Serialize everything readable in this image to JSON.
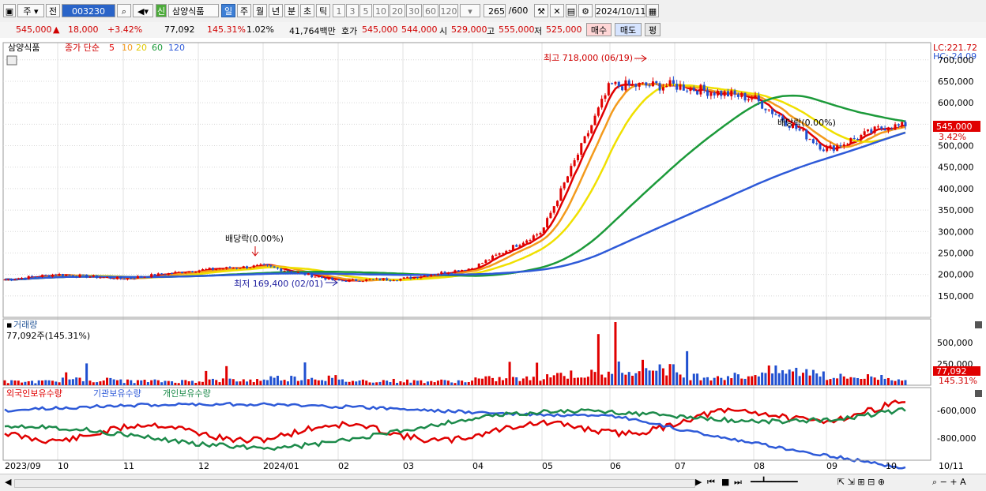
{
  "toolbar": {
    "market": "주",
    "code_type": "전",
    "code": "003230",
    "badge": "신",
    "stock_name": "삼양식품",
    "periods": [
      "일",
      "주",
      "월",
      "년",
      "분",
      "초",
      "틱"
    ],
    "active_period": "일",
    "numbers": [
      "1",
      "3",
      "5",
      "10",
      "20",
      "30",
      "60",
      "120"
    ],
    "count": "265",
    "count_max": "/600",
    "date": "2024/10/11"
  },
  "quote": {
    "price": "545,000",
    "change": "18,000",
    "change_pct": "+3.42%",
    "volume": "77,092",
    "volume_ratio": "145.31%",
    "turnover": "1.02%",
    "amount": "41,764백만",
    "bid_label": "호가",
    "bid1": "545,000",
    "bid2": "544,000",
    "open_label": "시",
    "open": "529,000",
    "high_label": "고",
    "high": "555,000",
    "low_label": "저",
    "low": "525,000",
    "buy_button": "매수",
    "sell_button": "매도",
    "eval_button": "평"
  },
  "price_panel": {
    "stock_tag": "삼양식품",
    "indicator_label": "종가 단순",
    "ma_periods": [
      {
        "label": "5",
        "color": "#e00000"
      },
      {
        "label": "10",
        "color": "#f39a1c"
      },
      {
        "label": "20",
        "color": "#f0e000"
      },
      {
        "label": "60",
        "color": "#1c9a3a"
      },
      {
        "label": "120",
        "color": "#2e5ad8"
      }
    ],
    "lc": "LC:221.72",
    "hc": "HC:-24.09",
    "current_tag": "545,000",
    "current_pct": "3.42%",
    "high_note": "최고 718,000 (06/19)",
    "low_note": "최저 169,400 (02/01)",
    "dividend_note_1": "배당락(0.00%)",
    "dividend_note_2": "배당락(0.00%)",
    "y_ticks": [
      "700,000",
      "650,000",
      "600,000",
      "550,000",
      "500,000",
      "450,000",
      "400,000",
      "350,000",
      "300,000",
      "250,000",
      "200,000",
      "150,000"
    ]
  },
  "volume_panel": {
    "title": "거래량",
    "info": "77,092주(145.31%)",
    "y_ticks": [
      "500,000",
      "250,000"
    ],
    "current_tag": "77,092",
    "current_pct": "145.31%"
  },
  "holding_panel": {
    "legend": [
      {
        "label": "외국인보유수량",
        "color": "#e00000"
      },
      {
        "label": "기관보유수량",
        "color": "#2e5ad8"
      },
      {
        "label": "개인보유수량",
        "color": "#1c8a4a"
      }
    ],
    "y_ticks": [
      "-600,000",
      "-800,000"
    ]
  },
  "x_axis": [
    "2023/09",
    "10",
    "11",
    "12",
    "2024/01",
    "02",
    "03",
    "04",
    "05",
    "06",
    "07",
    "08",
    "09",
    "10",
    "10/11"
  ],
  "chart_data": {
    "type": "line",
    "title": "삼양식품",
    "x": [
      "2023/09",
      "10",
      "11",
      "12",
      "2024/01",
      "02",
      "03",
      "04",
      "05",
      "06",
      "07",
      "08",
      "09",
      "10"
    ],
    "series": [
      {
        "name": "종가",
        "values": [
          188000,
          200000,
          190000,
          210000,
          220000,
          185000,
          190000,
          215000,
          300000,
          640000,
          640000,
          610000,
          490000,
          545000
        ]
      },
      {
        "name": "거래량",
        "values": [
          40000,
          60000,
          45000,
          55000,
          80000,
          50000,
          45000,
          70000,
          120000,
          200000,
          100000,
          150000,
          90000,
          77092
        ]
      }
    ],
    "ylim": [
      100000,
      740000
    ],
    "high": {
      "value": 718000,
      "date": "06/19"
    },
    "low": {
      "value": 169400,
      "date": "02/01"
    }
  }
}
